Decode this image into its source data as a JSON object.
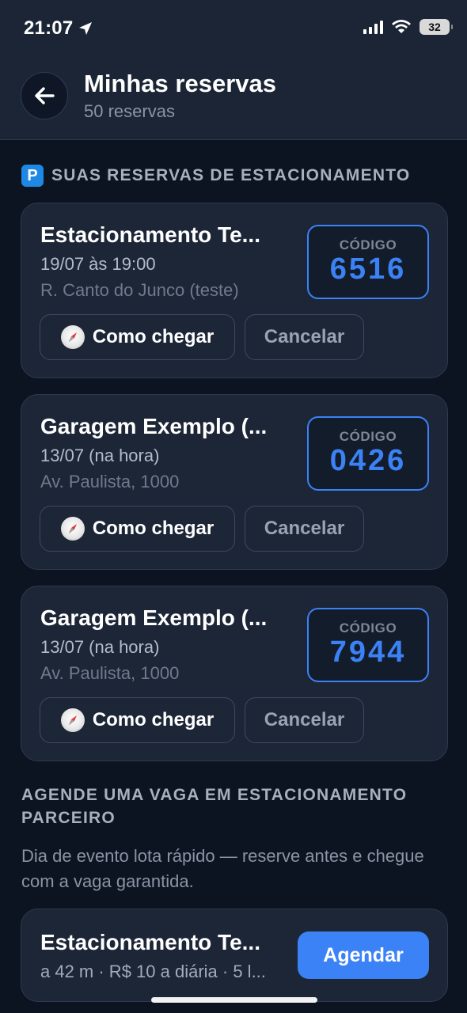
{
  "status_bar": {
    "time": "21:07",
    "battery": "32"
  },
  "header": {
    "title": "Minhas reservas",
    "subtitle": "50 reservas"
  },
  "reservations_section": {
    "badge": "P",
    "title": "SUAS RESERVAS DE ESTACIONAMENTO",
    "items": [
      {
        "name": "Estacionamento Te...",
        "when": "19/07 às 19:00",
        "address": "R. Canto do Junco (teste)",
        "code_label": "CÓDIGO",
        "code": "6516",
        "route_label": "Como chegar",
        "cancel_label": "Cancelar"
      },
      {
        "name": "Garagem Exemplo (...",
        "when": "13/07 (na hora)",
        "address": "Av. Paulista, 1000",
        "code_label": "CÓDIGO",
        "code": "0426",
        "route_label": "Como chegar",
        "cancel_label": "Cancelar"
      },
      {
        "name": "Garagem Exemplo (...",
        "when": "13/07 (na hora)",
        "address": "Av. Paulista, 1000",
        "code_label": "CÓDIGO",
        "code": "7944",
        "route_label": "Como chegar",
        "cancel_label": "Cancelar"
      }
    ]
  },
  "partner_section": {
    "title": "AGENDE UMA VAGA EM ESTACIONAMENTO PARCEIRO",
    "description": "Dia de evento lota rápido — reserve antes e chegue com a vaga garantida.",
    "card": {
      "name": "Estacionamento Te...",
      "meta": "a 42 m · R$ 10 a diária · 5 l...",
      "button_label": "Agendar"
    }
  },
  "colors": {
    "accent": "#3b82f6",
    "background": "#0d1421",
    "card": "#1c2637"
  }
}
